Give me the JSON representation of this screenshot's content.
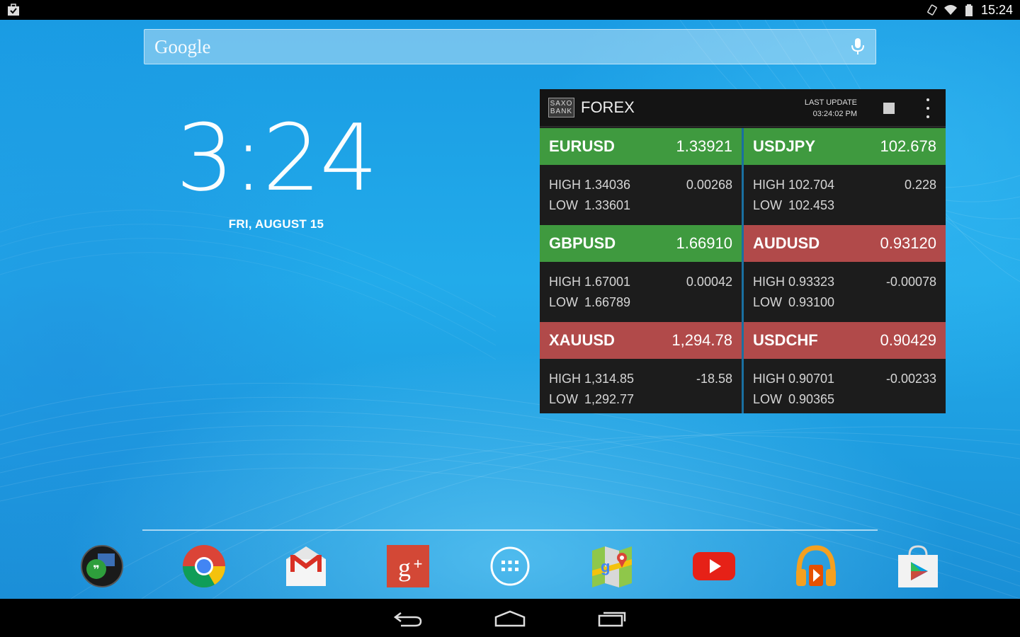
{
  "status_bar": {
    "time": "15:24"
  },
  "search": {
    "logo": "Google"
  },
  "clock": {
    "time": "3:24",
    "date": "FRI, AUGUST 15"
  },
  "forex": {
    "logo_line1": "SAXO",
    "logo_line2": "BANK",
    "title": "FOREX",
    "last_update_label": "LAST UPDATE",
    "last_update_time": "03:24:02 PM",
    "high_label": "HIGH",
    "low_label": "LOW",
    "pairs": [
      {
        "symbol": "EURUSD",
        "price": "1.33921",
        "high": "1.34036",
        "low": "1.33601",
        "change": "0.00268",
        "direction": "up"
      },
      {
        "symbol": "USDJPY",
        "price": "102.678",
        "high": "102.704",
        "low": "102.453",
        "change": "0.228",
        "direction": "up"
      },
      {
        "symbol": "GBPUSD",
        "price": "1.66910",
        "high": "1.67001",
        "low": "1.66789",
        "change": "0.00042",
        "direction": "up"
      },
      {
        "symbol": "AUDUSD",
        "price": "0.93120",
        "high": "0.93323",
        "low": "0.93100",
        "change": "-0.00078",
        "direction": "down"
      },
      {
        "symbol": "XAUUSD",
        "price": "1,294.78",
        "high": "1,314.85",
        "low": "1,292.77",
        "change": "-18.58",
        "direction": "down"
      },
      {
        "symbol": "USDCHF",
        "price": "0.90429",
        "high": "0.90701",
        "low": "0.90365",
        "change": "-0.00233",
        "direction": "down"
      }
    ]
  },
  "colors": {
    "up": "#3f9a3f",
    "down": "#b14a4a"
  },
  "dock": {
    "apps": [
      "hangouts-icon",
      "chrome-icon",
      "gmail-icon",
      "google-plus-icon",
      "app-drawer-icon",
      "maps-icon",
      "youtube-icon",
      "play-music-icon",
      "play-store-icon"
    ]
  }
}
